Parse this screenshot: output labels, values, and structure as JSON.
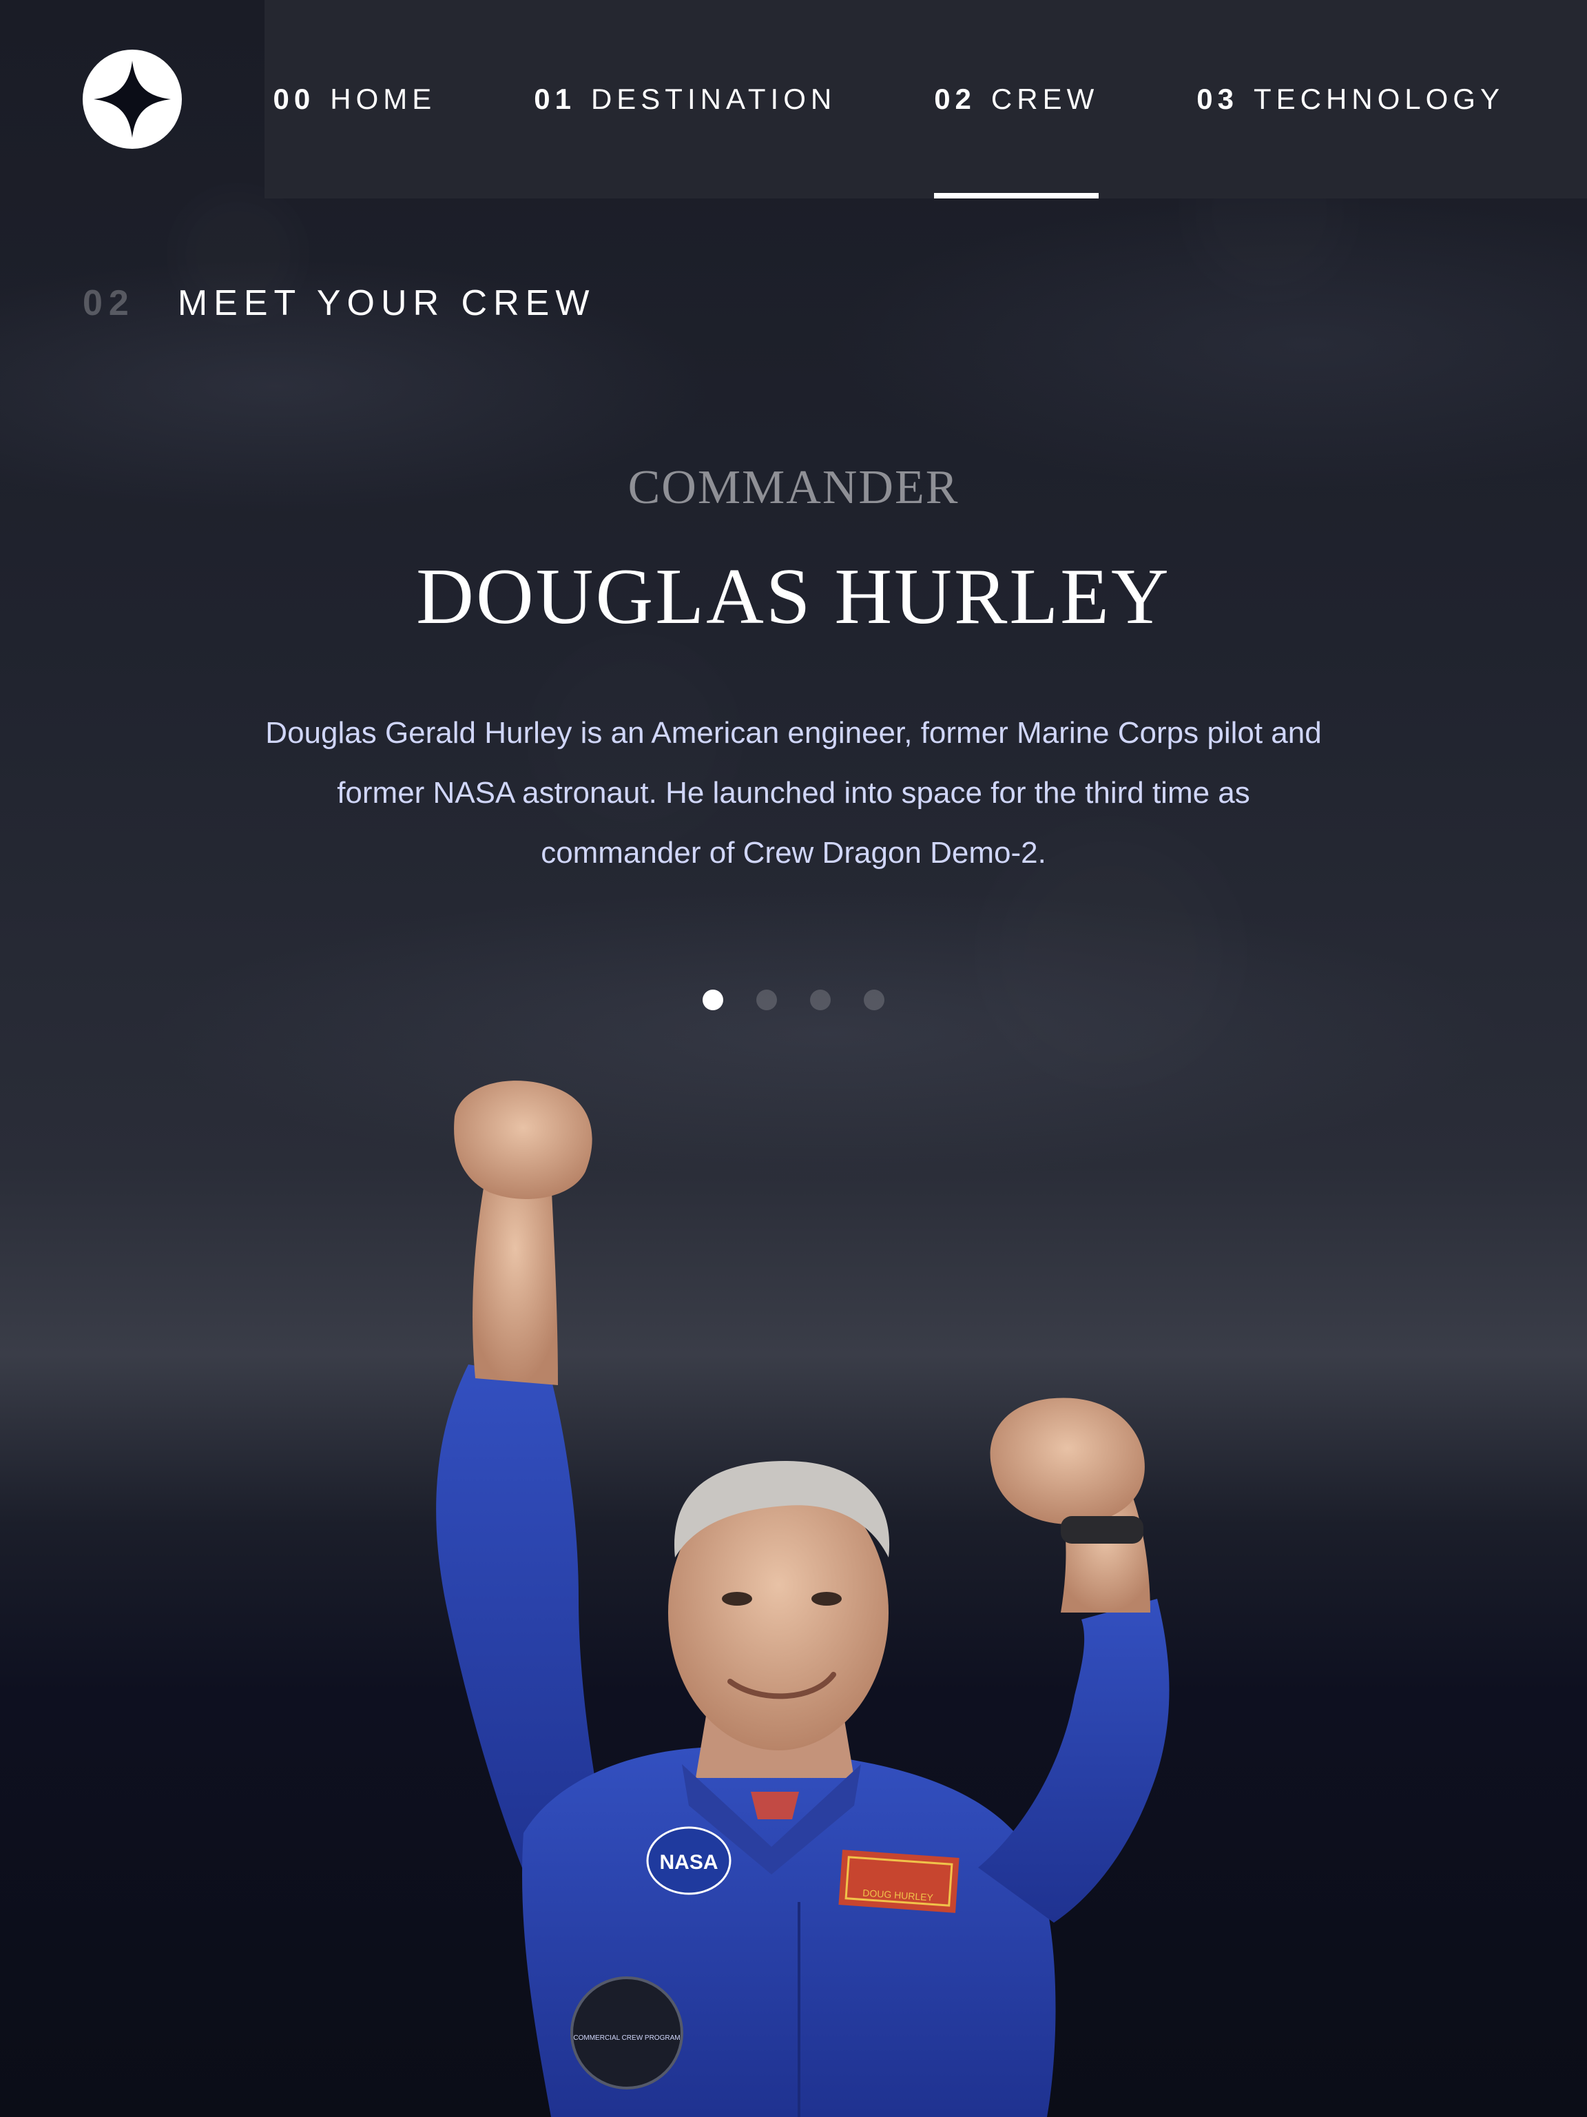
{
  "nav": {
    "items": [
      {
        "num": "00",
        "label": "HOME"
      },
      {
        "num": "01",
        "label": "DESTINATION"
      },
      {
        "num": "02",
        "label": "CREW"
      },
      {
        "num": "03",
        "label": "TECHNOLOGY"
      }
    ],
    "active_index": 2
  },
  "section": {
    "num": "02",
    "title": "MEET YOUR CREW"
  },
  "crew": {
    "role": "COMMANDER",
    "name": "DOUGLAS HURLEY",
    "bio": "Douglas Gerald Hurley is an American engineer, former Marine Corps pilot and former NASA astronaut. He launched into space for the third time as commander of Crew Dragon Demo-2.",
    "patch_text": "DOUG HURLEY",
    "nasa_badge": "NASA",
    "program_badge": "COMMERCIAL CREW PROGRAM"
  },
  "pagination": {
    "count": 4,
    "active_index": 0
  },
  "colors": {
    "background": "#0b0d17",
    "nav_bg": "#252730",
    "text_light": "#d0d6f9",
    "suit_blue": "#2b44a8"
  },
  "icons": {
    "logo": "four-point-star-icon"
  }
}
